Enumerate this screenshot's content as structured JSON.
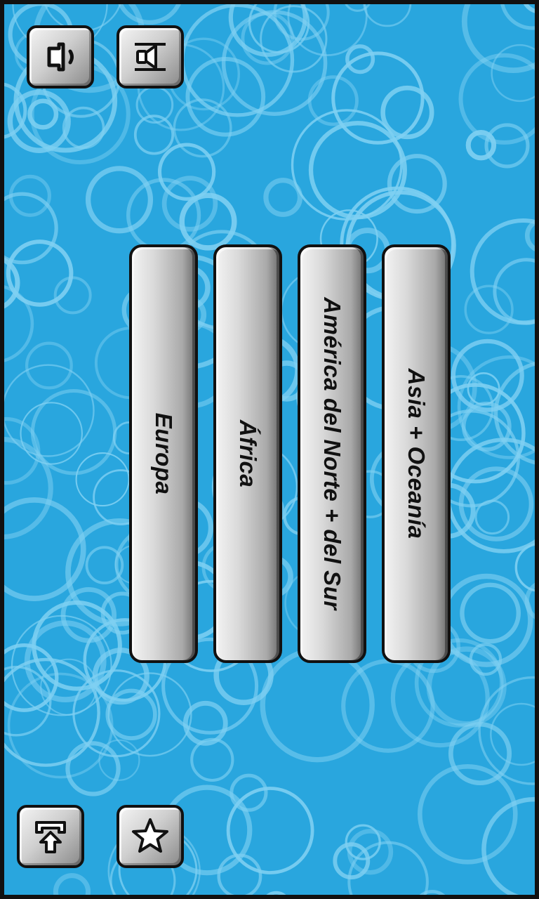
{
  "colors": {
    "background": "#29a6de",
    "bubble_stroke": "#7fd0f2",
    "button_text": "#111111",
    "frame": "#111111"
  },
  "toolbar": {
    "top": [
      {
        "icon": "speaker-icon"
      },
      {
        "icon": "sound-waves-icon"
      }
    ],
    "bottom": [
      {
        "icon": "exit-arrow-icon"
      },
      {
        "icon": "star-icon"
      }
    ]
  },
  "regions": {
    "europe": "Europa",
    "africa": "África",
    "america": "América del Norte + del Sur",
    "asia": "Asia + Oceanía"
  }
}
